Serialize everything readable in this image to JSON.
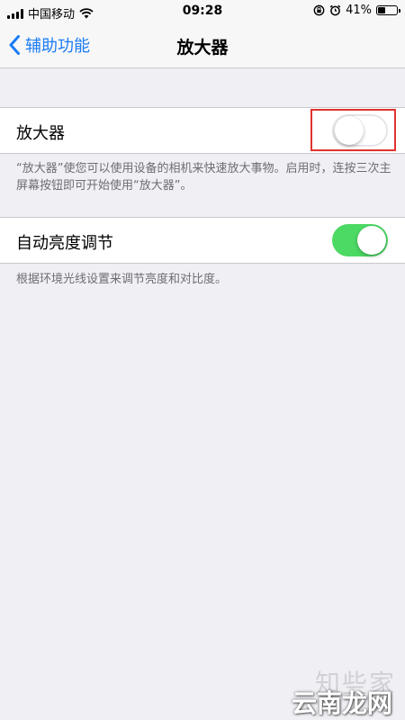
{
  "status_bar": {
    "carrier": "中国移动",
    "time": "09:28",
    "battery_text": "41%",
    "battery_level": 0.41,
    "icons": [
      "signal-icon",
      "wifi-icon",
      "orientation-lock-icon",
      "alarm-icon",
      "battery-icon"
    ]
  },
  "nav": {
    "back_label": "辅助功能",
    "title": "放大器"
  },
  "magnifier": {
    "label": "放大器",
    "toggle_on": false,
    "footnote": "“放大器”使您可以使用设备的相机来快速放大事物。启用时，连按三次主屏幕按钮即可开始使用“放大器”。"
  },
  "auto_brightness": {
    "label": "自动亮度调节",
    "toggle_on": true,
    "footnote": "根据环境光线设置来调节亮度和对比度。"
  },
  "watermarks": {
    "top": "知些家",
    "bottom": "云南龙网"
  },
  "colors": {
    "accent": "#1a7cf5",
    "switch_on": "#4cd964",
    "highlight": "#e0332f",
    "background": "#efeff4"
  }
}
